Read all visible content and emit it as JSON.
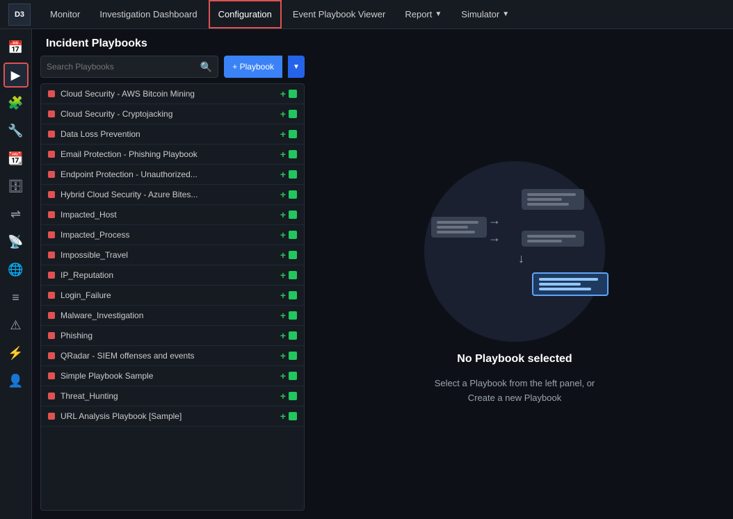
{
  "app": {
    "logo": "D3"
  },
  "topnav": {
    "items": [
      {
        "id": "monitor",
        "label": "Monitor",
        "active": false,
        "dropdown": false
      },
      {
        "id": "investigation-dashboard",
        "label": "Investigation Dashboard",
        "active": false,
        "dropdown": false
      },
      {
        "id": "configuration",
        "label": "Configuration",
        "active": true,
        "dropdown": false
      },
      {
        "id": "event-playbook-viewer",
        "label": "Event Playbook Viewer",
        "active": false,
        "dropdown": false
      },
      {
        "id": "report",
        "label": "Report",
        "active": false,
        "dropdown": true
      },
      {
        "id": "simulator",
        "label": "Simulator",
        "active": false,
        "dropdown": true
      }
    ]
  },
  "sidebar": {
    "icons": [
      {
        "id": "calendar",
        "symbol": "📅",
        "active": false
      },
      {
        "id": "playbook",
        "symbol": "▶",
        "active": true
      },
      {
        "id": "puzzle",
        "symbol": "🧩",
        "active": false
      },
      {
        "id": "tools",
        "symbol": "🔧",
        "active": false
      },
      {
        "id": "calendar2",
        "symbol": "📆",
        "active": false
      },
      {
        "id": "database",
        "symbol": "🗄",
        "active": false
      },
      {
        "id": "share",
        "symbol": "⇌",
        "active": false
      },
      {
        "id": "antenna",
        "symbol": "📡",
        "active": false
      },
      {
        "id": "globe",
        "symbol": "🌐",
        "active": false
      },
      {
        "id": "layers",
        "symbol": "≡",
        "active": false
      },
      {
        "id": "alert",
        "symbol": "⚠",
        "active": false
      },
      {
        "id": "bolt",
        "symbol": "⚡",
        "active": false
      },
      {
        "id": "user",
        "symbol": "👤",
        "active": false
      }
    ]
  },
  "page": {
    "title": "Incident Playbooks"
  },
  "toolbar": {
    "search_placeholder": "Search Playbooks",
    "add_playbook_label": "+ Playbook"
  },
  "playbooks": {
    "items": [
      {
        "name": "Cloud Security - AWS Bitcoin Mining"
      },
      {
        "name": "Cloud Security - Cryptojacking"
      },
      {
        "name": "Data Loss Prevention"
      },
      {
        "name": "Email Protection - Phishing Playbook"
      },
      {
        "name": "Endpoint Protection - Unauthorized..."
      },
      {
        "name": "Hybrid Cloud Security - Azure Bites..."
      },
      {
        "name": "Impacted_Host"
      },
      {
        "name": "Impacted_Process"
      },
      {
        "name": "Impossible_Travel"
      },
      {
        "name": "IP_Reputation"
      },
      {
        "name": "Login_Failure"
      },
      {
        "name": "Malware_Investigation"
      },
      {
        "name": "Phishing"
      },
      {
        "name": "QRadar - SIEM offenses and events"
      },
      {
        "name": "Simple Playbook Sample"
      },
      {
        "name": "Threat_Hunting"
      },
      {
        "name": "URL Analysis Playbook [Sample]"
      }
    ]
  },
  "empty_state": {
    "title": "No Playbook selected",
    "description": "Select a Playbook from the left panel, or\nCreate a new Playbook"
  }
}
